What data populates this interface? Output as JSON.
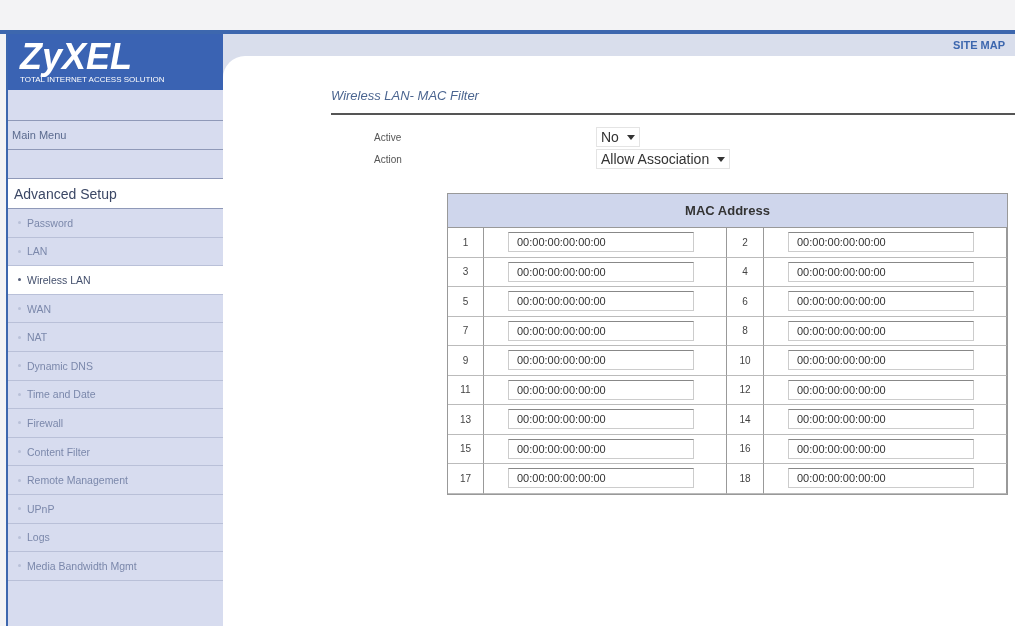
{
  "logo": {
    "name": "ZyXEL",
    "tagline": "TOTAL INTERNET ACCESS SOLUTION"
  },
  "header": {
    "site_map": "SITE MAP"
  },
  "sidebar": {
    "main_menu": "Main Menu",
    "section": "Advanced Setup",
    "items": [
      {
        "label": "Password",
        "selected": false
      },
      {
        "label": "LAN",
        "selected": false
      },
      {
        "label": "Wireless LAN",
        "selected": true
      },
      {
        "label": "WAN",
        "selected": false
      },
      {
        "label": "NAT",
        "selected": false
      },
      {
        "label": "Dynamic DNS",
        "selected": false
      },
      {
        "label": "Time and Date",
        "selected": false
      },
      {
        "label": "Firewall",
        "selected": false
      },
      {
        "label": "Content Filter",
        "selected": false
      },
      {
        "label": "Remote Management",
        "selected": false
      },
      {
        "label": "UPnP",
        "selected": false
      },
      {
        "label": "Logs",
        "selected": false
      },
      {
        "label": "Media Bandwidth Mgmt",
        "selected": false
      }
    ]
  },
  "page_title": "Wireless LAN- MAC Filter",
  "settings": [
    {
      "label": "Active",
      "value": "No"
    },
    {
      "label": "Action",
      "value": "Allow Association"
    }
  ],
  "table": {
    "heading": "MAC Address",
    "entries": [
      {
        "index": "1",
        "value": "00:00:00:00:00:00"
      },
      {
        "index": "2",
        "value": "00:00:00:00:00:00"
      },
      {
        "index": "3",
        "value": "00:00:00:00:00:00"
      },
      {
        "index": "4",
        "value": "00:00:00:00:00:00"
      },
      {
        "index": "5",
        "value": "00:00:00:00:00:00"
      },
      {
        "index": "6",
        "value": "00:00:00:00:00:00"
      },
      {
        "index": "7",
        "value": "00:00:00:00:00:00"
      },
      {
        "index": "8",
        "value": "00:00:00:00:00:00"
      },
      {
        "index": "9",
        "value": "00:00:00:00:00:00"
      },
      {
        "index": "10",
        "value": "00:00:00:00:00:00"
      },
      {
        "index": "11",
        "value": "00:00:00:00:00:00"
      },
      {
        "index": "12",
        "value": "00:00:00:00:00:00"
      },
      {
        "index": "13",
        "value": "00:00:00:00:00:00"
      },
      {
        "index": "14",
        "value": "00:00:00:00:00:00"
      },
      {
        "index": "15",
        "value": "00:00:00:00:00:00"
      },
      {
        "index": "16",
        "value": "00:00:00:00:00:00"
      },
      {
        "index": "17",
        "value": "00:00:00:00:00:00"
      },
      {
        "index": "18",
        "value": "00:00:00:00:00:00"
      }
    ]
  }
}
